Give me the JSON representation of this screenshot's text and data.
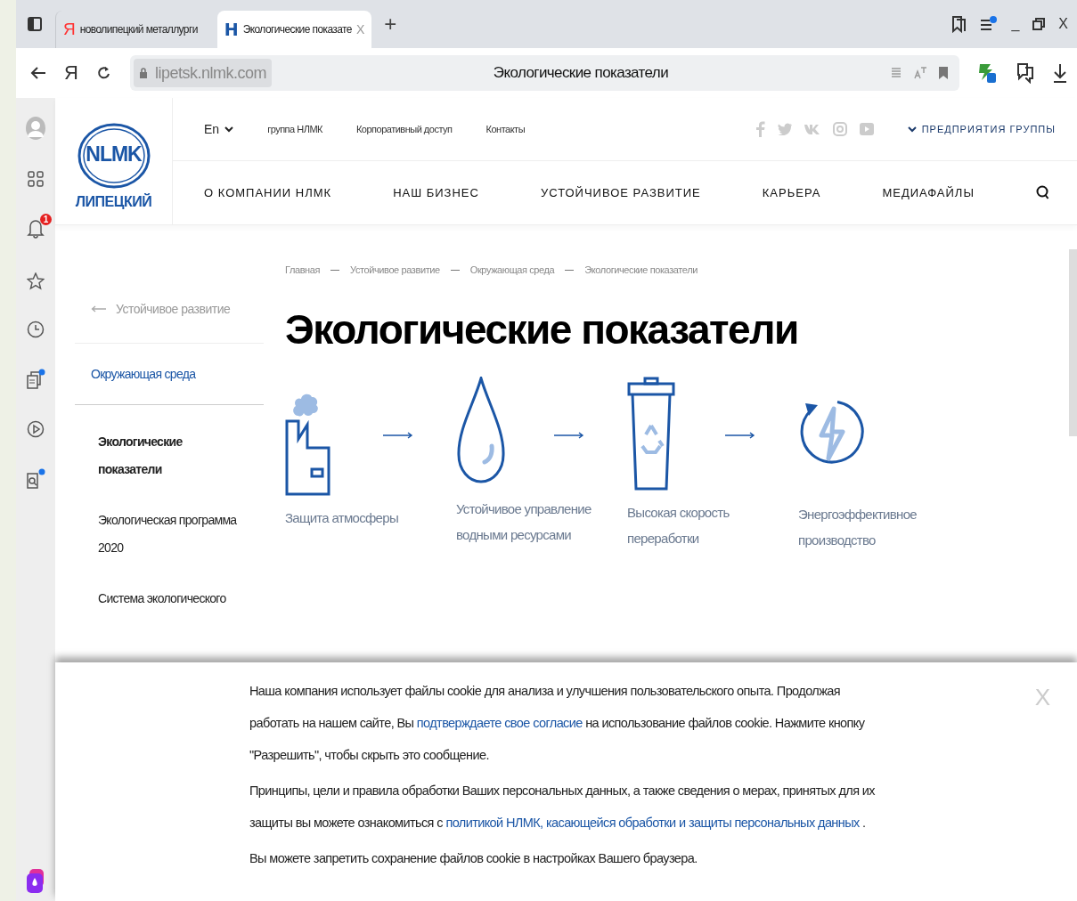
{
  "browser": {
    "tabs": [
      {
        "favicon": "Я",
        "kind": "yandex",
        "title": "новолипецкий металлурги",
        "selected": false
      },
      {
        "favicon": "Н",
        "kind": "site",
        "title": "Экологические показате",
        "close": "X",
        "selected": true
      }
    ],
    "new_tab": "+",
    "window_buttons": [
      "_",
      "X"
    ],
    "home_glyph": "Я",
    "address": {
      "domain": "lipetsk.nlmk.com",
      "page_title": "Экологические показатели"
    },
    "notification_count": "1"
  },
  "site": {
    "logo": {
      "mark": "NLMK",
      "city": "ЛИПЕЦКИЙ"
    },
    "language": "En",
    "top_links": [
      "группа НЛМК",
      "Корпоративный доступ",
      "Контакты"
    ],
    "group_link": "ПРЕДПРИЯТИЯ ГРУППЫ",
    "nav": [
      "О КОМПАНИИ НЛМК",
      "НАШ БИЗНЕС",
      "УСТОЙЧИВОЕ РАЗВИТИЕ",
      "КАРЬЕРА",
      "МЕДИАФАЙЛЫ"
    ]
  },
  "breadcrumbs": [
    "Главная",
    "Устойчивое развитие",
    "Окружающая среда",
    "Экологические показатели"
  ],
  "back_link": "Устойчивое развитие",
  "side_menu": [
    {
      "kind": "section",
      "label": "Окружающая среда"
    },
    {
      "kind": "item",
      "label": "Экологические показатели",
      "selected": true
    },
    {
      "kind": "item",
      "label": "Экологическая программа 2020",
      "selected": false
    },
    {
      "kind": "item",
      "label": "Система экологического",
      "selected": false
    }
  ],
  "title": "Экологические показатели",
  "steps": [
    {
      "kind": "factory",
      "label": "Защита атмосферы"
    },
    {
      "kind": "drop",
      "label": "Устойчивое управление водными ресурсами"
    },
    {
      "kind": "bin",
      "label": "Высокая скорость переработки"
    },
    {
      "kind": "energy",
      "label": "Энергоэффективное производство"
    }
  ],
  "cookie": {
    "close": "X",
    "paragraphs": [
      [
        {
          "text": "Наша компания использует файлы cookie для анализа и улучшения пользовательского опыта. Продолжая работать на нашем сайте, Вы ",
          "link": false
        },
        {
          "text": "подтверждаете свое согласие",
          "link": true
        },
        {
          "text": " на использование файлов cookie. Нажмите кнопку \"Разрешить\", чтобы скрыть это сообщение.",
          "link": false
        }
      ],
      [
        {
          "text": "Принципы, цели и правила обработки Ваших персональных данных, а также сведения о мерах, принятых для их защиты вы можете ознакомиться с ",
          "link": false
        },
        {
          "text": "политикой НЛМК, касающейся обработки и защиты ",
          "link": true
        },
        {
          "text": "персональных данных",
          "link": true
        },
        {
          "text": " .",
          "link": false
        }
      ],
      [
        {
          "text": "Вы можете запретить сохранение файлов cookie в настройках Вашего браузера.",
          "link": false
        }
      ]
    ]
  }
}
